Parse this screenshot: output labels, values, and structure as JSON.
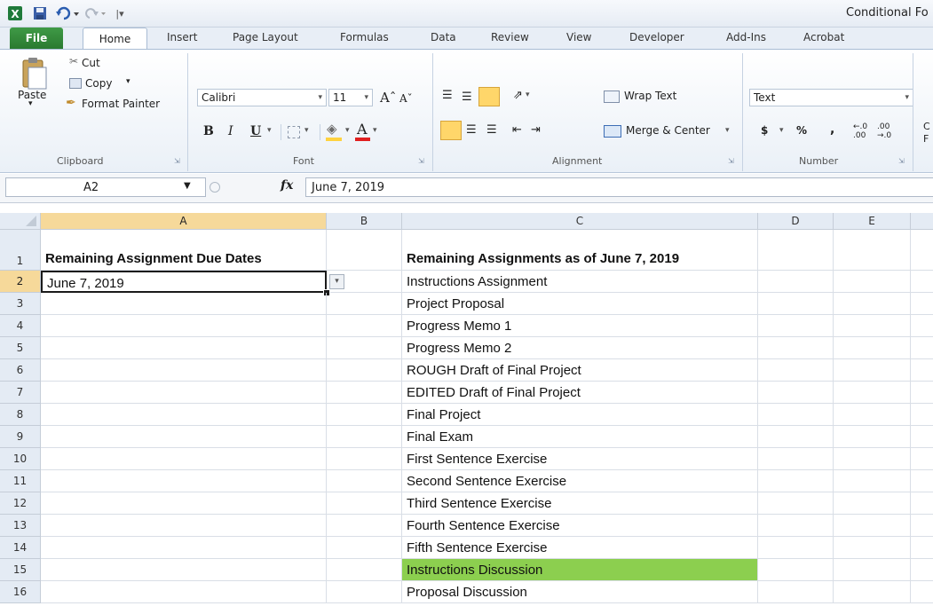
{
  "window": {
    "title": "Conditional Fo"
  },
  "quick_access": {
    "icons": [
      "excel-icon",
      "save-icon",
      "undo-icon",
      "redo-icon",
      "customize-icon"
    ]
  },
  "tabs": [
    "File",
    "Home",
    "Insert",
    "Page Layout",
    "Formulas",
    "Data",
    "Review",
    "View",
    "Developer",
    "Add-Ins",
    "Acrobat"
  ],
  "ribbon": {
    "clipboard": {
      "paste": "Paste",
      "cut": "Cut",
      "copy": "Copy",
      "format_painter": "Format Painter",
      "label": "Clipboard"
    },
    "font": {
      "name": "Calibri",
      "size": "11",
      "bold": "B",
      "italic": "I",
      "underline": "U",
      "label": "Font"
    },
    "alignment": {
      "wrap_text": "Wrap Text",
      "merge_center": "Merge & Center",
      "label": "Alignment"
    },
    "number": {
      "format": "Text",
      "currency": "$",
      "percent": "%",
      "comma": ",",
      "label": "Number"
    },
    "cut_off": "C\nF"
  },
  "formula_bar": {
    "name_box": "A2",
    "fx": "fx",
    "value": "June 7, 2019"
  },
  "columns": [
    "A",
    "B",
    "C",
    "D",
    "E"
  ],
  "rows": [
    {
      "num": "1",
      "a": "Remaining Assignment Due Dates",
      "c": "Remaining Assignments as of June 7, 2019"
    },
    {
      "num": "2",
      "a": "June 7, 2019",
      "c": "Instructions Assignment"
    },
    {
      "num": "3",
      "a": "",
      "c": "Project Proposal"
    },
    {
      "num": "4",
      "a": "",
      "c": "Progress Memo 1"
    },
    {
      "num": "5",
      "a": "",
      "c": "Progress Memo 2"
    },
    {
      "num": "6",
      "a": "",
      "c": "ROUGH Draft of Final Project"
    },
    {
      "num": "7",
      "a": "",
      "c": "EDITED Draft of Final Project"
    },
    {
      "num": "8",
      "a": "",
      "c": "Final Project"
    },
    {
      "num": "9",
      "a": "",
      "c": "Final Exam"
    },
    {
      "num": "10",
      "a": "",
      "c": "First Sentence Exercise"
    },
    {
      "num": "11",
      "a": "",
      "c": "Second Sentence Exercise"
    },
    {
      "num": "12",
      "a": "",
      "c": "Third Sentence Exercise"
    },
    {
      "num": "13",
      "a": "",
      "c": "Fourth Sentence Exercise"
    },
    {
      "num": "14",
      "a": "",
      "c": "Fifth Sentence Exercise"
    },
    {
      "num": "15",
      "a": "",
      "c": "Instructions Discussion"
    },
    {
      "num": "16",
      "a": "",
      "c": "Proposal Discussion"
    }
  ],
  "colors": {
    "highlight": "#8ccf4f",
    "selected_header": "#f6d99a",
    "file_tab": "#2e7d32",
    "fill_yellow": "#ffd23f",
    "font_red": "#e02020"
  }
}
